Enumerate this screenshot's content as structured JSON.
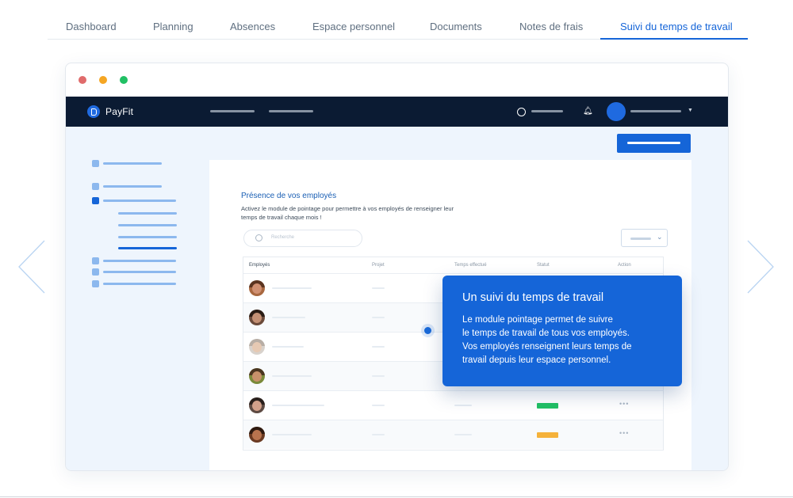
{
  "tabs": [
    {
      "label": "Dashboard",
      "active": false
    },
    {
      "label": "Planning",
      "active": false
    },
    {
      "label": "Absences",
      "active": false
    },
    {
      "label": "Espace personnel",
      "active": false
    },
    {
      "label": "Documents",
      "active": false
    },
    {
      "label": "Notes de frais",
      "active": false
    },
    {
      "label": "Suivi du temps de travail",
      "active": true
    }
  ],
  "app": {
    "logo_text": "PayFit"
  },
  "card": {
    "title": "Présence de vos employés",
    "subtitle": "Activez le module de pointage pour permettre à vos employés de renseigner leur temps de travail chaque mois !",
    "search_placeholder": "Recherche"
  },
  "table": {
    "headers": [
      "Employés",
      "Projet",
      "Temps effectué",
      "Statut",
      "Action"
    ],
    "rows": [
      {
        "status_color": null
      },
      {
        "status_color": null
      },
      {
        "status_color": null
      },
      {
        "status_color": null
      },
      {
        "status_color": "#21c064"
      },
      {
        "status_color": "#f5b23a"
      }
    ]
  },
  "tooltip": {
    "title": "Un suivi du temps de travail",
    "body": "Le module pointage permet de suivre\nle temps de travail de tous vos employés.\nVos employés renseignent leurs temps de\ntravail depuis leur espace personnel."
  },
  "colors": {
    "accent": "#1565d8",
    "navbar": "#0b1b33",
    "status_green": "#21c064",
    "status_orange": "#f5b23a"
  },
  "icons": {
    "arrows": [
      "chevron-left-icon",
      "chevron-right-icon"
    ],
    "navbar": [
      "search-icon",
      "bell-icon",
      "caret-down-icon"
    ]
  }
}
